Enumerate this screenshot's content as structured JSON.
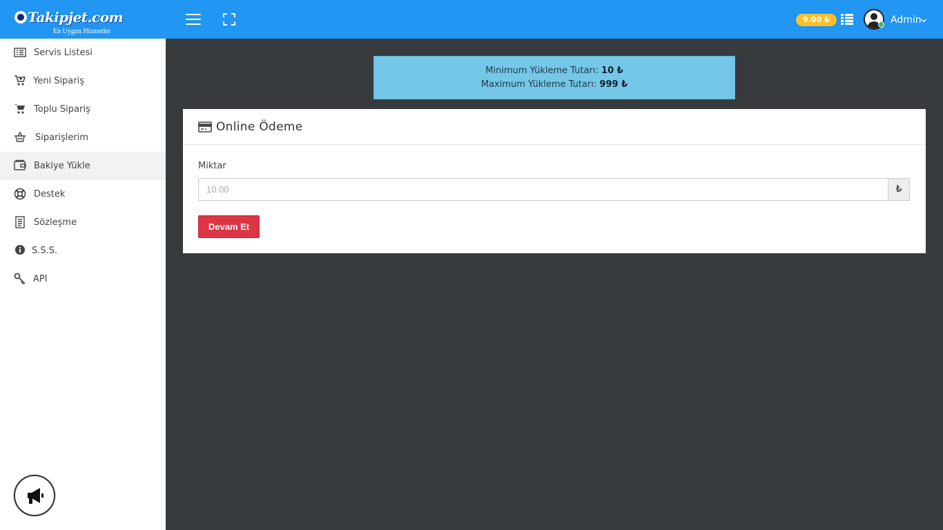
{
  "header": {
    "logo_text": "Takipjet.com",
    "logo_subtitle": "En Uygun Hizmetler",
    "balance": "9.00 ₺",
    "user_name": "Admin",
    "menu_icon": "hamburger-icon",
    "fullscreen_icon": "fullscreen-icon",
    "list_icon": "list-icon",
    "colors": {
      "bar": "#2196f3",
      "balance_badge": "#fbc02d",
      "online": "#4caf50"
    }
  },
  "sidebar": {
    "items": [
      {
        "label": "Servis Listesi",
        "icon": "list-alt-icon",
        "active": false
      },
      {
        "label": "Yeni Sipariş",
        "icon": "cart-plus-icon",
        "active": false
      },
      {
        "label": "Toplu Sipariş",
        "icon": "cart-icon",
        "active": false
      },
      {
        "label": "Siparişlerim",
        "icon": "basket-icon",
        "active": false
      },
      {
        "label": "Bakiye Yükle",
        "icon": "wallet-icon",
        "active": true
      },
      {
        "label": "Destek",
        "icon": "lifebuoy-icon",
        "active": false
      },
      {
        "label": "Sözleşme",
        "icon": "document-icon",
        "active": false
      },
      {
        "label": "S.S.S.",
        "icon": "info-icon",
        "active": false
      },
      {
        "label": "API",
        "icon": "key-icon",
        "active": false
      }
    ],
    "announcement_icon": "megaphone-icon"
  },
  "alert": {
    "min_label": "Minimum Yükleme Tutarı:",
    "min_value": "10 ₺",
    "max_label": "Maximum Yükleme Tutarı:",
    "max_value": "999 ₺",
    "color": "#74c7e6"
  },
  "payment": {
    "title": "Online Ödeme",
    "title_icon": "credit-card-icon",
    "amount_label": "Miktar",
    "amount_value": "",
    "amount_placeholder": "10.00",
    "currency": "₺",
    "submit_label": "Devam Et",
    "submit_color": "#dc3545"
  }
}
